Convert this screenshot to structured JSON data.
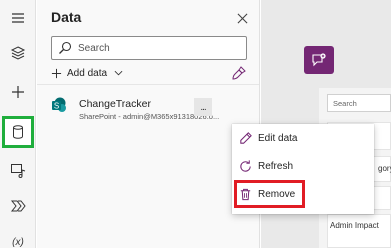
{
  "panel": {
    "title": "Data",
    "search_placeholder": "Search",
    "add_data_label": "Add data"
  },
  "datasource": {
    "name": "ChangeTracker",
    "subtitle": "SharePoint - admin@M365x91318026.o...",
    "more_label": "..."
  },
  "context_menu": {
    "items": [
      {
        "label": "Edit data",
        "icon": "pencil-icon"
      },
      {
        "label": "Refresh",
        "icon": "refresh-icon"
      },
      {
        "label": "Remove",
        "icon": "trash-icon"
      }
    ]
  },
  "canvas": {
    "search_placeholder": "Search",
    "category_fragment": "gory",
    "admin_label": "Admin Impact"
  },
  "rail": {
    "items": [
      "hamburger-icon",
      "layers-icon",
      "plus-icon",
      "data-icon",
      "media-icon",
      "flow-icon",
      "variables-icon"
    ],
    "variables_label": "(x)"
  },
  "colors": {
    "accent_green": "#1fae3c",
    "highlight_red": "#e11c24",
    "powerapps_purple": "#742774",
    "sharepoint_teal": "#036c70"
  }
}
